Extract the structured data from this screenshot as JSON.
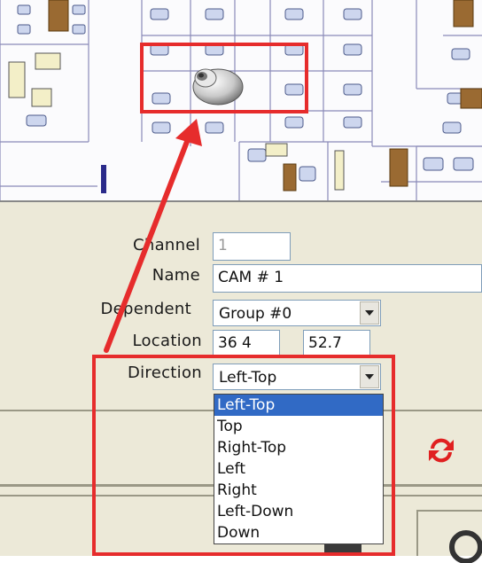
{
  "props": {
    "channel_label": "Channel",
    "channel_value": "1",
    "name_label": "Name",
    "name_value": "CAM # 1",
    "dependent_label": "Dependent",
    "dependent_value": "Group #0",
    "location_label": "Location",
    "location_x": "36 4",
    "location_y": "52.7",
    "direction_label": "Direction",
    "direction_value": "Left-Top"
  },
  "dropdown": {
    "options": [
      "Left-Top",
      "Top",
      "Right-Top",
      "Left",
      "Right",
      "Left-Down",
      "Down"
    ],
    "selected_index": 0
  },
  "icons": {
    "camera": "ptz-camera-icon",
    "refresh": "refresh-arrows-icon",
    "arrow": "annotation-arrow",
    "highlight": "annotation-highlight-box"
  },
  "colors": {
    "highlight": "#e62c2c",
    "panel": "#ece9d8",
    "selection": "#316ac5"
  }
}
